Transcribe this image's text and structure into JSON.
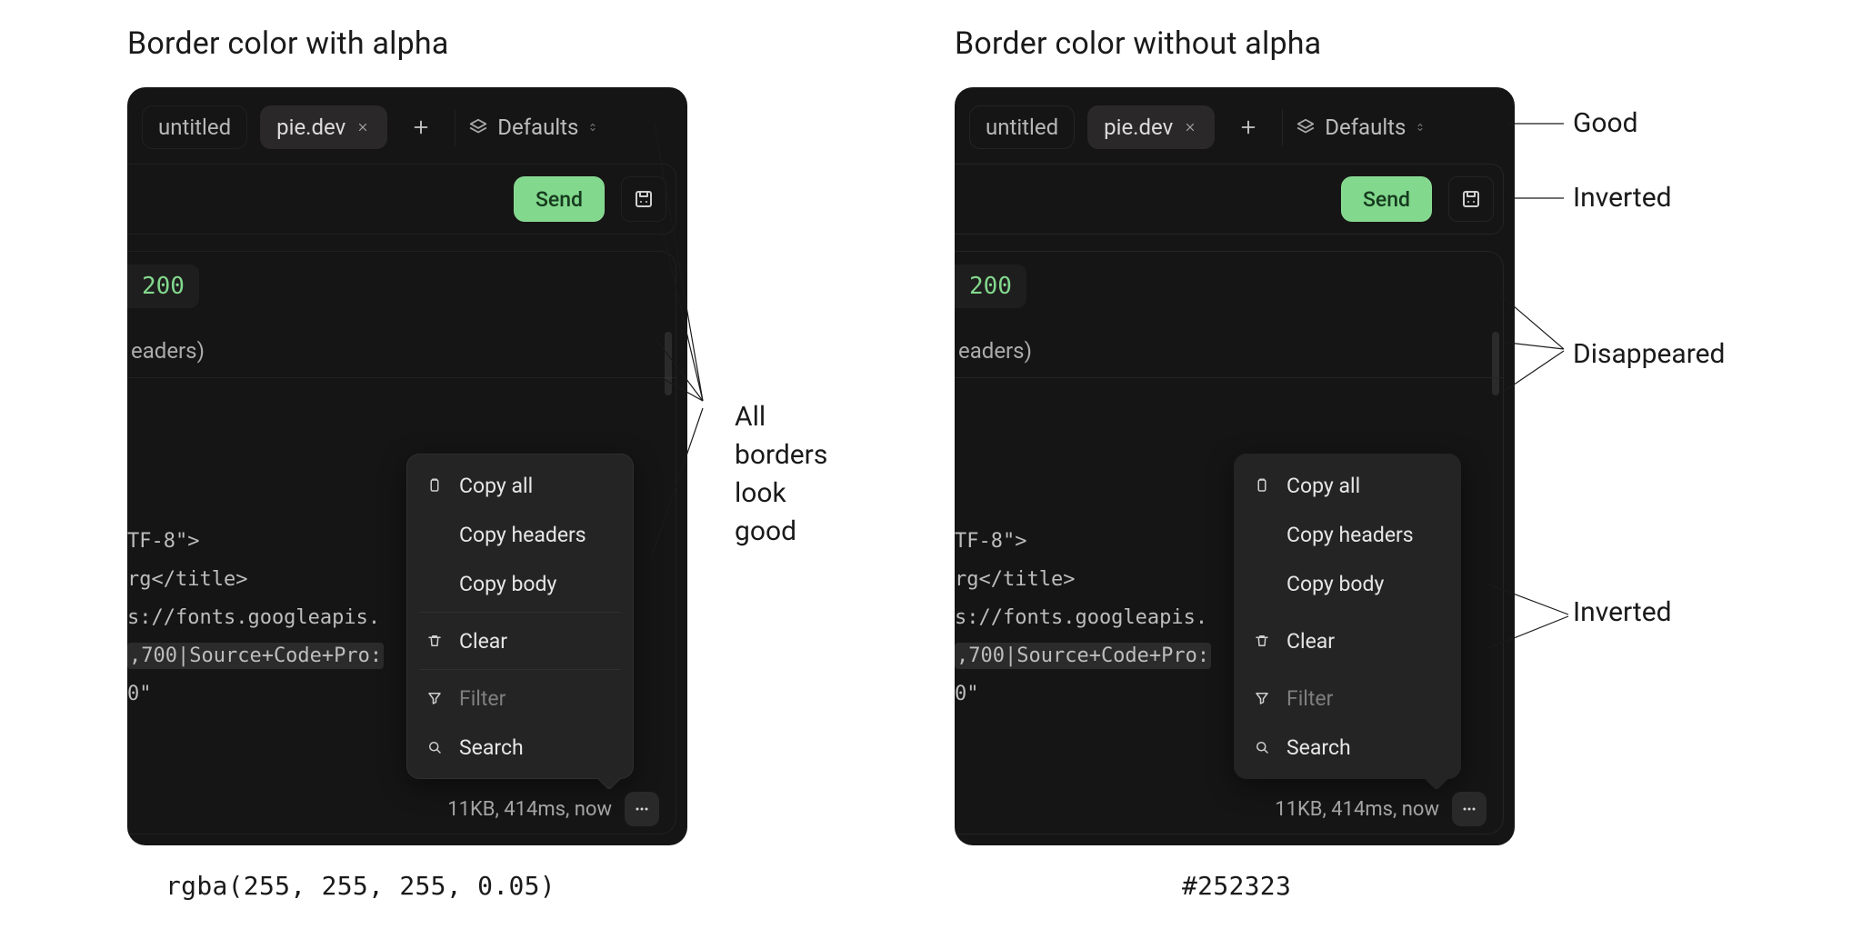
{
  "figure": {
    "left_title": "Border color with alpha",
    "right_title": "Border color without alpha",
    "left_caption": "rgba(255, 255, 255, 0.05)",
    "right_caption": "#252323"
  },
  "panel": {
    "tabs": {
      "inactive_label": "untitled",
      "active_label": "pie.dev"
    },
    "env_label": "Defaults",
    "send_label": "Send",
    "status_code": "200",
    "headers_fragment": "eaders)",
    "code_lines": {
      "l1": "TF-8\">",
      "l2": "rg</title>",
      "l3": "s://fonts.googleapis.",
      "l4": ",700|Source+Code+Pro:",
      "l5": "0\""
    },
    "statusbar_text": "11KB, 414ms, now",
    "menu": {
      "copy_all": "Copy all",
      "copy_headers": "Copy headers",
      "copy_body": "Copy body",
      "clear": "Clear",
      "filter": "Filter",
      "search": "Search"
    }
  },
  "annotations": {
    "left_all_good_l1": "All borders",
    "left_all_good_l2": "look good",
    "right_good": "Good",
    "right_inverted": "Inverted",
    "right_disappeared": "Disappeared",
    "right_inverted2": "Inverted"
  }
}
